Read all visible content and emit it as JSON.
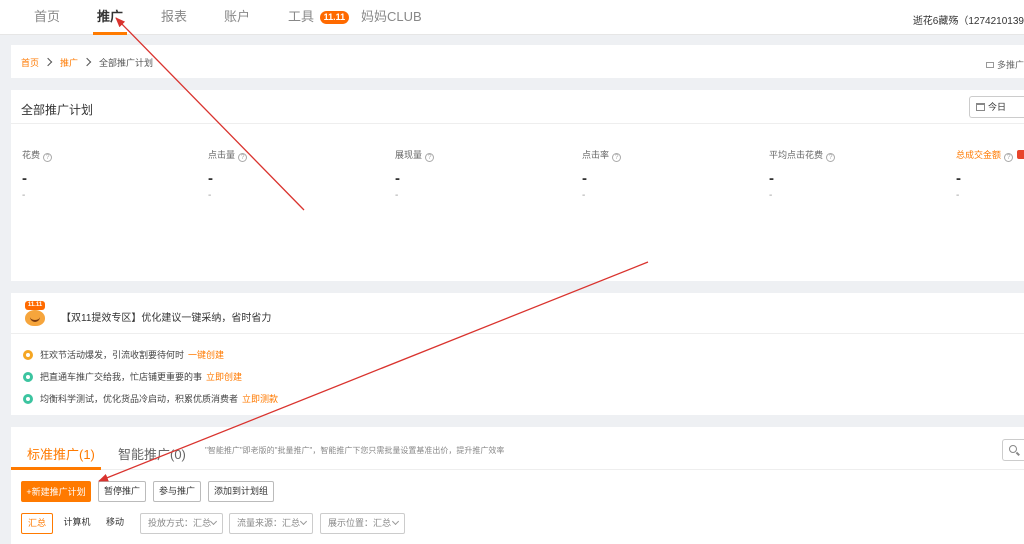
{
  "topnav": {
    "tabs": [
      {
        "label": "首页"
      },
      {
        "label": "推广"
      },
      {
        "label": "报表"
      },
      {
        "label": "账户"
      },
      {
        "label": "工具",
        "badge": "11.11"
      },
      {
        "label": "妈妈CLUB"
      }
    ],
    "user": "逝花6藏殇（1274210139"
  },
  "breadcrumb": {
    "home": "首页",
    "promo": "推广",
    "current": "全部推广计划",
    "multi": "多推广"
  },
  "plan_panel": {
    "title": "全部推广计划",
    "date": "今日",
    "metrics": [
      {
        "label": "花费",
        "value": "-",
        "sub": "-"
      },
      {
        "label": "点击量",
        "value": "-",
        "sub": "-"
      },
      {
        "label": "展现量",
        "value": "-",
        "sub": "-"
      },
      {
        "label": "点击率",
        "value": "-",
        "sub": "-"
      },
      {
        "label": "平均点击花费",
        "value": "-",
        "sub": "-"
      },
      {
        "label": "总成交金额",
        "value": "-",
        "sub": "-"
      }
    ]
  },
  "promo_panel": {
    "mascot_badge": "11.11",
    "headline": "【双11提效专区】优化建议一键采纳，省时省力",
    "tips": [
      {
        "text": "狂欢节活动爆发，引流收割要待何时",
        "link": "一键创建",
        "color": "#f5a623"
      },
      {
        "text": "把直通车推广交给我，忙店铺更重要的事",
        "link": "立即创建",
        "color": "#3cc4a0"
      },
      {
        "text": "均衡科学测试，优化货品冷启动，积累优质消费者",
        "link": "立即测款",
        "color": "#3cc4a0"
      }
    ]
  },
  "standard_panel": {
    "tab_standard": "标准推广(1)",
    "tab_smart": "智能推广(0)",
    "note": "\"智能推广\"即老版的\"批量推广\"，智能推广下您只需批量设置基准出价，提升推广效率",
    "buttons": {
      "new_plan": "+新建推广计划",
      "pause": "暂停推广",
      "join": "参与推广",
      "add_group": "添加到计划组"
    },
    "segments": [
      "汇总",
      "计算机",
      "移动"
    ],
    "filters": [
      "投放方式：汇总",
      "流量来源：汇总",
      "展示位置：汇总"
    ]
  },
  "colors": {
    "accent": "#ff7a00",
    "arrow": "#d9332e"
  }
}
